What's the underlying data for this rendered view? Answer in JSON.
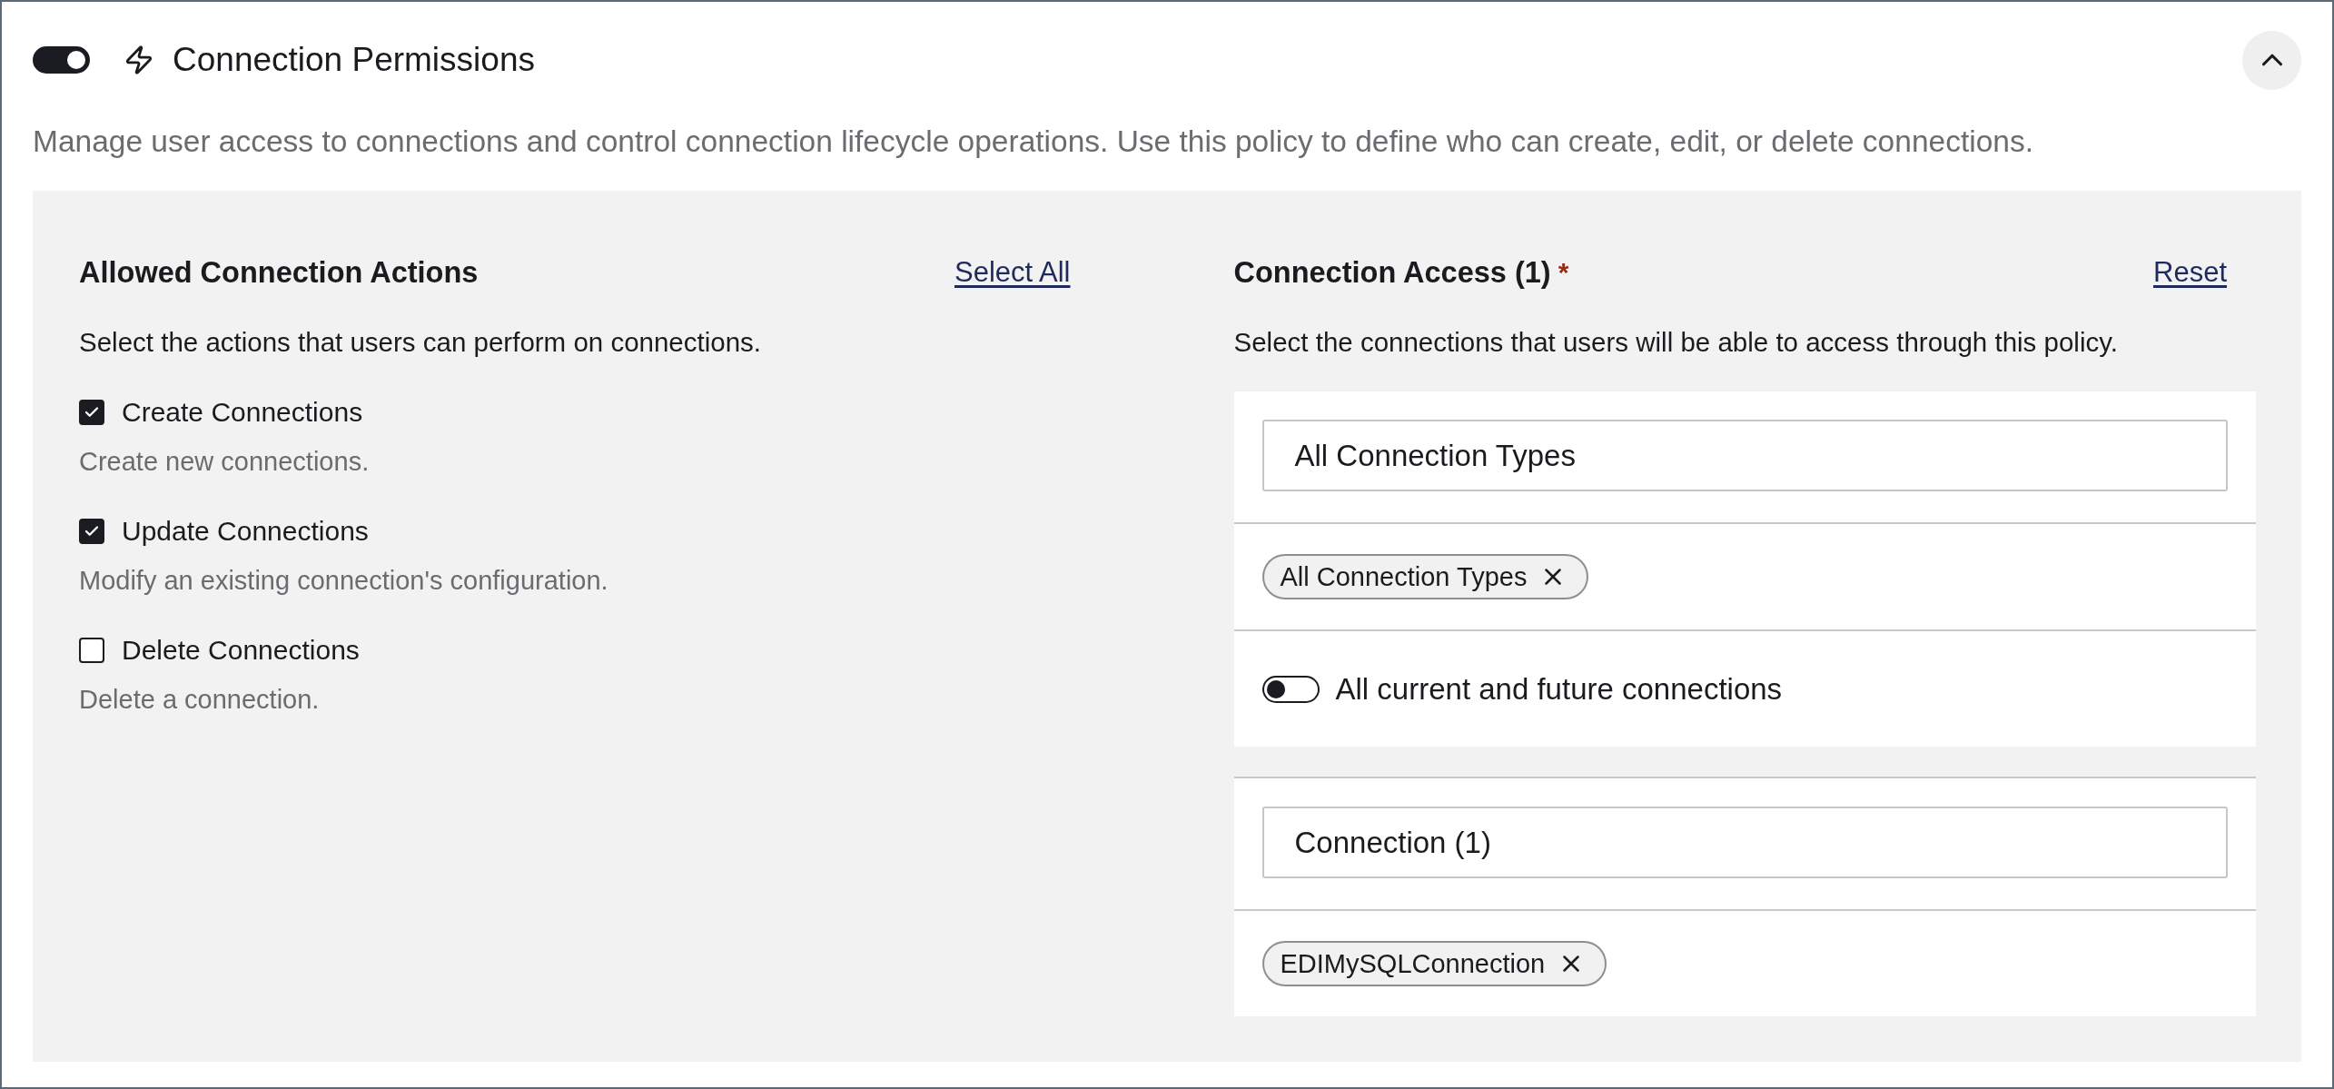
{
  "section": {
    "title": "Connection Permissions",
    "enabled": true,
    "expanded": true,
    "description": "Manage user access to connections and control connection lifecycle operations. Use this policy to define who can create, edit, or delete connections."
  },
  "actions": {
    "heading": "Allowed Connection Actions",
    "select_all": "Select All",
    "intro": "Select the actions that users can perform on connections.",
    "items": [
      {
        "label": "Create Connections",
        "description": "Create new connections.",
        "checked": true
      },
      {
        "label": "Update Connections",
        "description": "Modify an existing connection's configuration.",
        "checked": true
      },
      {
        "label": "Delete Connections",
        "description": "Delete a connection.",
        "checked": false
      }
    ]
  },
  "access": {
    "heading": "Connection Access (1)",
    "required_mark": "*",
    "reset": "Reset",
    "intro": "Select the connections that users will be able to access through this policy.",
    "type_filter": {
      "value": "All Connection Types",
      "chips": [
        "All Connection Types"
      ],
      "all_connections": {
        "label": "All current and future connections",
        "on": false
      }
    },
    "connection_filter": {
      "value": "Connection (1)",
      "chips": [
        "EDIMySQLConnection"
      ]
    }
  }
}
